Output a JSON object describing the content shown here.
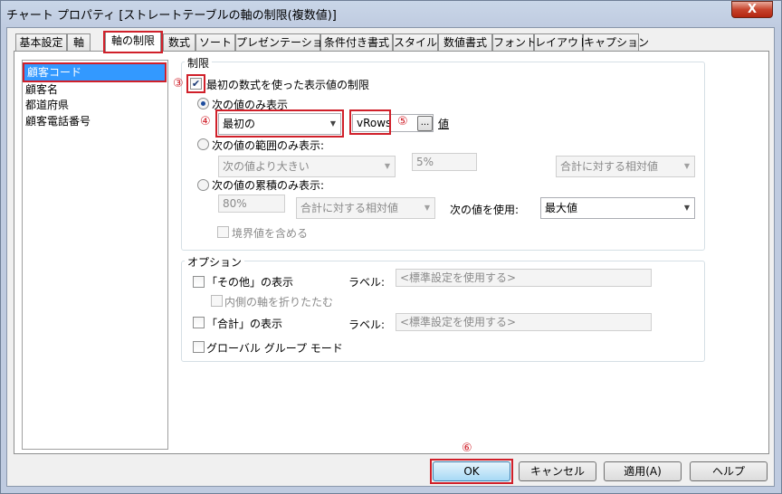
{
  "window": {
    "title": "チャート プロパティ [ストレートテーブルの軸の制限(複数値)]",
    "close_label": "X"
  },
  "tabs": [
    {
      "label": "基本設定"
    },
    {
      "label": "軸"
    },
    {
      "label": "軸の制限"
    },
    {
      "label": "数式"
    },
    {
      "label": "ソート"
    },
    {
      "label": "プレゼンテーション"
    },
    {
      "label": "条件付き書式"
    },
    {
      "label": "スタイル"
    },
    {
      "label": "数値書式"
    },
    {
      "label": "フォント"
    },
    {
      "label": "レイアウト"
    },
    {
      "label": "キャプション"
    }
  ],
  "dimensions": [
    "顧客コード",
    "顧客名",
    "都道府県",
    "顧客電話番号"
  ],
  "limits": {
    "group_label": "制限",
    "restrict_label": "最初の数式を使った表示値の制限",
    "restrict_checked": true,
    "show_only": {
      "label": "次の値のみ表示",
      "selected_value": "最初の",
      "count_value": "vRows",
      "ellipsis": "...",
      "suffix": "値"
    },
    "range": {
      "label": "次の値の範囲のみ表示:",
      "comparison": "次の値より大きい",
      "percent": "5%",
      "relative": "合計に対する相対値"
    },
    "accumulate": {
      "label": "次の値の累積のみ表示:",
      "percent": "80%",
      "relative": "合計に対する相対値",
      "use_value_label": "次の値を使用:",
      "use_value": "最大値"
    },
    "include_boundary_label": "境界値を含める"
  },
  "options": {
    "group_label": "オプション",
    "show_others_label": "「その他」の表示",
    "collapse_inner_label": "内側の軸を折りたたむ",
    "show_total_label": "「合計」の表示",
    "global_group_label": "グローバル グループ モード",
    "label_caption": "ラベル:",
    "others_label_placeholder": "<標準設定を使用する>",
    "total_label_placeholder": "<標準設定を使用する>"
  },
  "annotations": {
    "n3": "③",
    "n4": "④",
    "n5": "⑤",
    "n6": "⑥"
  },
  "footer": {
    "ok": "OK",
    "cancel": "キャンセル",
    "apply": "適用(A)",
    "help": "ヘルプ"
  },
  "colors": {
    "highlight_border": "#d0202a",
    "selection": "#3399ff"
  }
}
